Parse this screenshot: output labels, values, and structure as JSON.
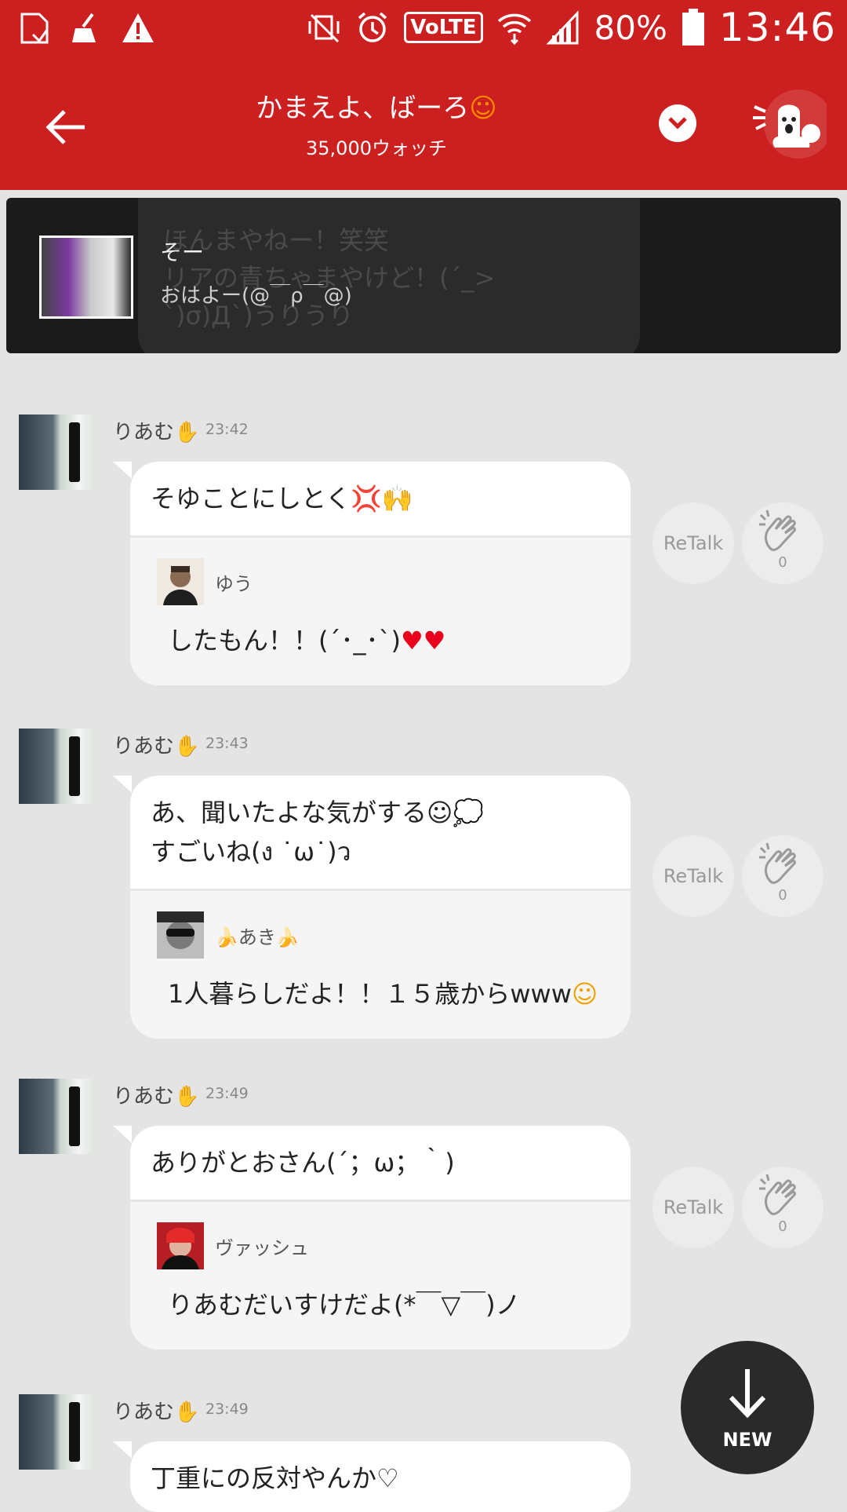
{
  "status_bar": {
    "battery_percent": "80%",
    "time": "13:46",
    "volte": "VoLTE"
  },
  "header": {
    "title": "かまえよ、ばーろ",
    "title_emoji": "☺",
    "subtitle": "35,000ウォッチ"
  },
  "pinned": {
    "name": "そー",
    "message": "おはよー(@￣ρ￣@)",
    "ghost_line_1": "ほんまやねー！笑笑",
    "ghost_line_2": "リアの青ちゃまやけど！(´_>",
    "ghost_line_3": "`)σ)Д`)うりうり"
  },
  "messages": [
    {
      "user": "りあむ",
      "badge": "✋",
      "time": "23:42",
      "text": "そゆことにしとく",
      "text_emoji": "💢🙌",
      "quote_user": "ゆう",
      "quote_text": "したもん！！(´･_･`)",
      "quote_emoji": "♥♥",
      "retalk": "ReTalk",
      "clap_count": "0"
    },
    {
      "user": "りあむ",
      "badge": "✋",
      "time": "23:43",
      "text_line_1": "あ、聞いたよな気がする☺💭",
      "text_line_2": "すごいね(ง ˙ω˙)ว",
      "quote_user": "🍌あき🍌",
      "quote_text": "1人暮らしだよ！！１５歳からwww",
      "quote_emoji": "☺",
      "retalk": "ReTalk",
      "clap_count": "0"
    },
    {
      "user": "りあむ",
      "badge": "✋",
      "time": "23:49",
      "text": "ありがとおさん(´；ω；｀)",
      "quote_user": "ヴァッシュ",
      "quote_text": "りあむだいすけだよ(*￣▽￣)ノ",
      "retalk": "ReTalk",
      "clap_count": "0"
    },
    {
      "user": "りあむ",
      "badge": "✋",
      "time": "23:49",
      "text": "丁重にの反対やんか",
      "text_emoji": "♡"
    }
  ],
  "new_button": {
    "label": "NEW"
  }
}
